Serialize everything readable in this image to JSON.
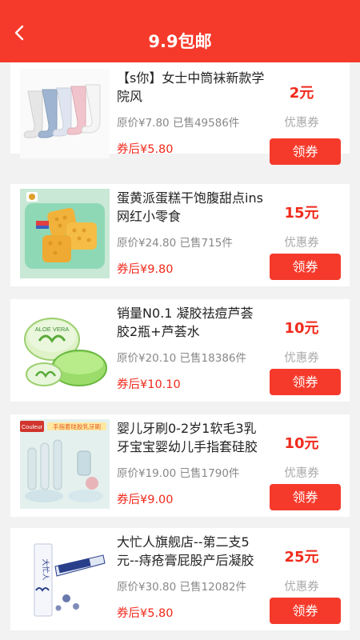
{
  "header": {
    "title": "9.9包邮"
  },
  "products": [
    {
      "name": "【s你】女士中筒袜新款学院风",
      "original_price": "原价¥7.80",
      "sold": "已售49586件",
      "after_coupon": "券后¥5.80",
      "coupon_amount": "2元",
      "coupon_label": "优惠券",
      "button_label": "领券",
      "image": "socks"
    },
    {
      "name": "蛋黄派蛋糕干饱腹甜点ins网红小零食",
      "original_price": "原价¥24.80",
      "sold": "已售715件",
      "after_coupon": "券后¥9.80",
      "coupon_amount": "15元",
      "coupon_label": "优惠券",
      "button_label": "领券",
      "image": "cake"
    },
    {
      "name": "销量N0.1 凝胶祛痘芦荟胶2瓶+芦荟水",
      "original_price": "原价¥20.10",
      "sold": "已售18386件",
      "after_coupon": "券后¥10.10",
      "coupon_amount": "10元",
      "coupon_label": "优惠券",
      "button_label": "领券",
      "image": "aloe",
      "image_text": "ALOE VERA"
    },
    {
      "name": "婴儿牙刷0-2岁1软毛3乳牙宝宝婴幼儿手指套硅胶",
      "original_price": "原价¥19.00",
      "sold": "已售1790件",
      "after_coupon": "券后¥9.00",
      "coupon_amount": "10元",
      "coupon_label": "优惠券",
      "button_label": "领券",
      "image": "toothbrush",
      "image_text": "Couleur",
      "image_banner": "手指套硅胶乳牙刷"
    },
    {
      "name": "大忙人旗舰店--第二支5元--痔疮膏屁股产后凝胶",
      "original_price": "原价¥30.80",
      "sold": "已售12082件",
      "after_coupon": "券后¥5.80",
      "coupon_amount": "25元",
      "coupon_label": "优惠券",
      "button_label": "领券",
      "image": "ointment",
      "image_text": "大忙人"
    }
  ],
  "colors": {
    "accent": "#f53a2b",
    "price_red": "#f02a1c"
  }
}
